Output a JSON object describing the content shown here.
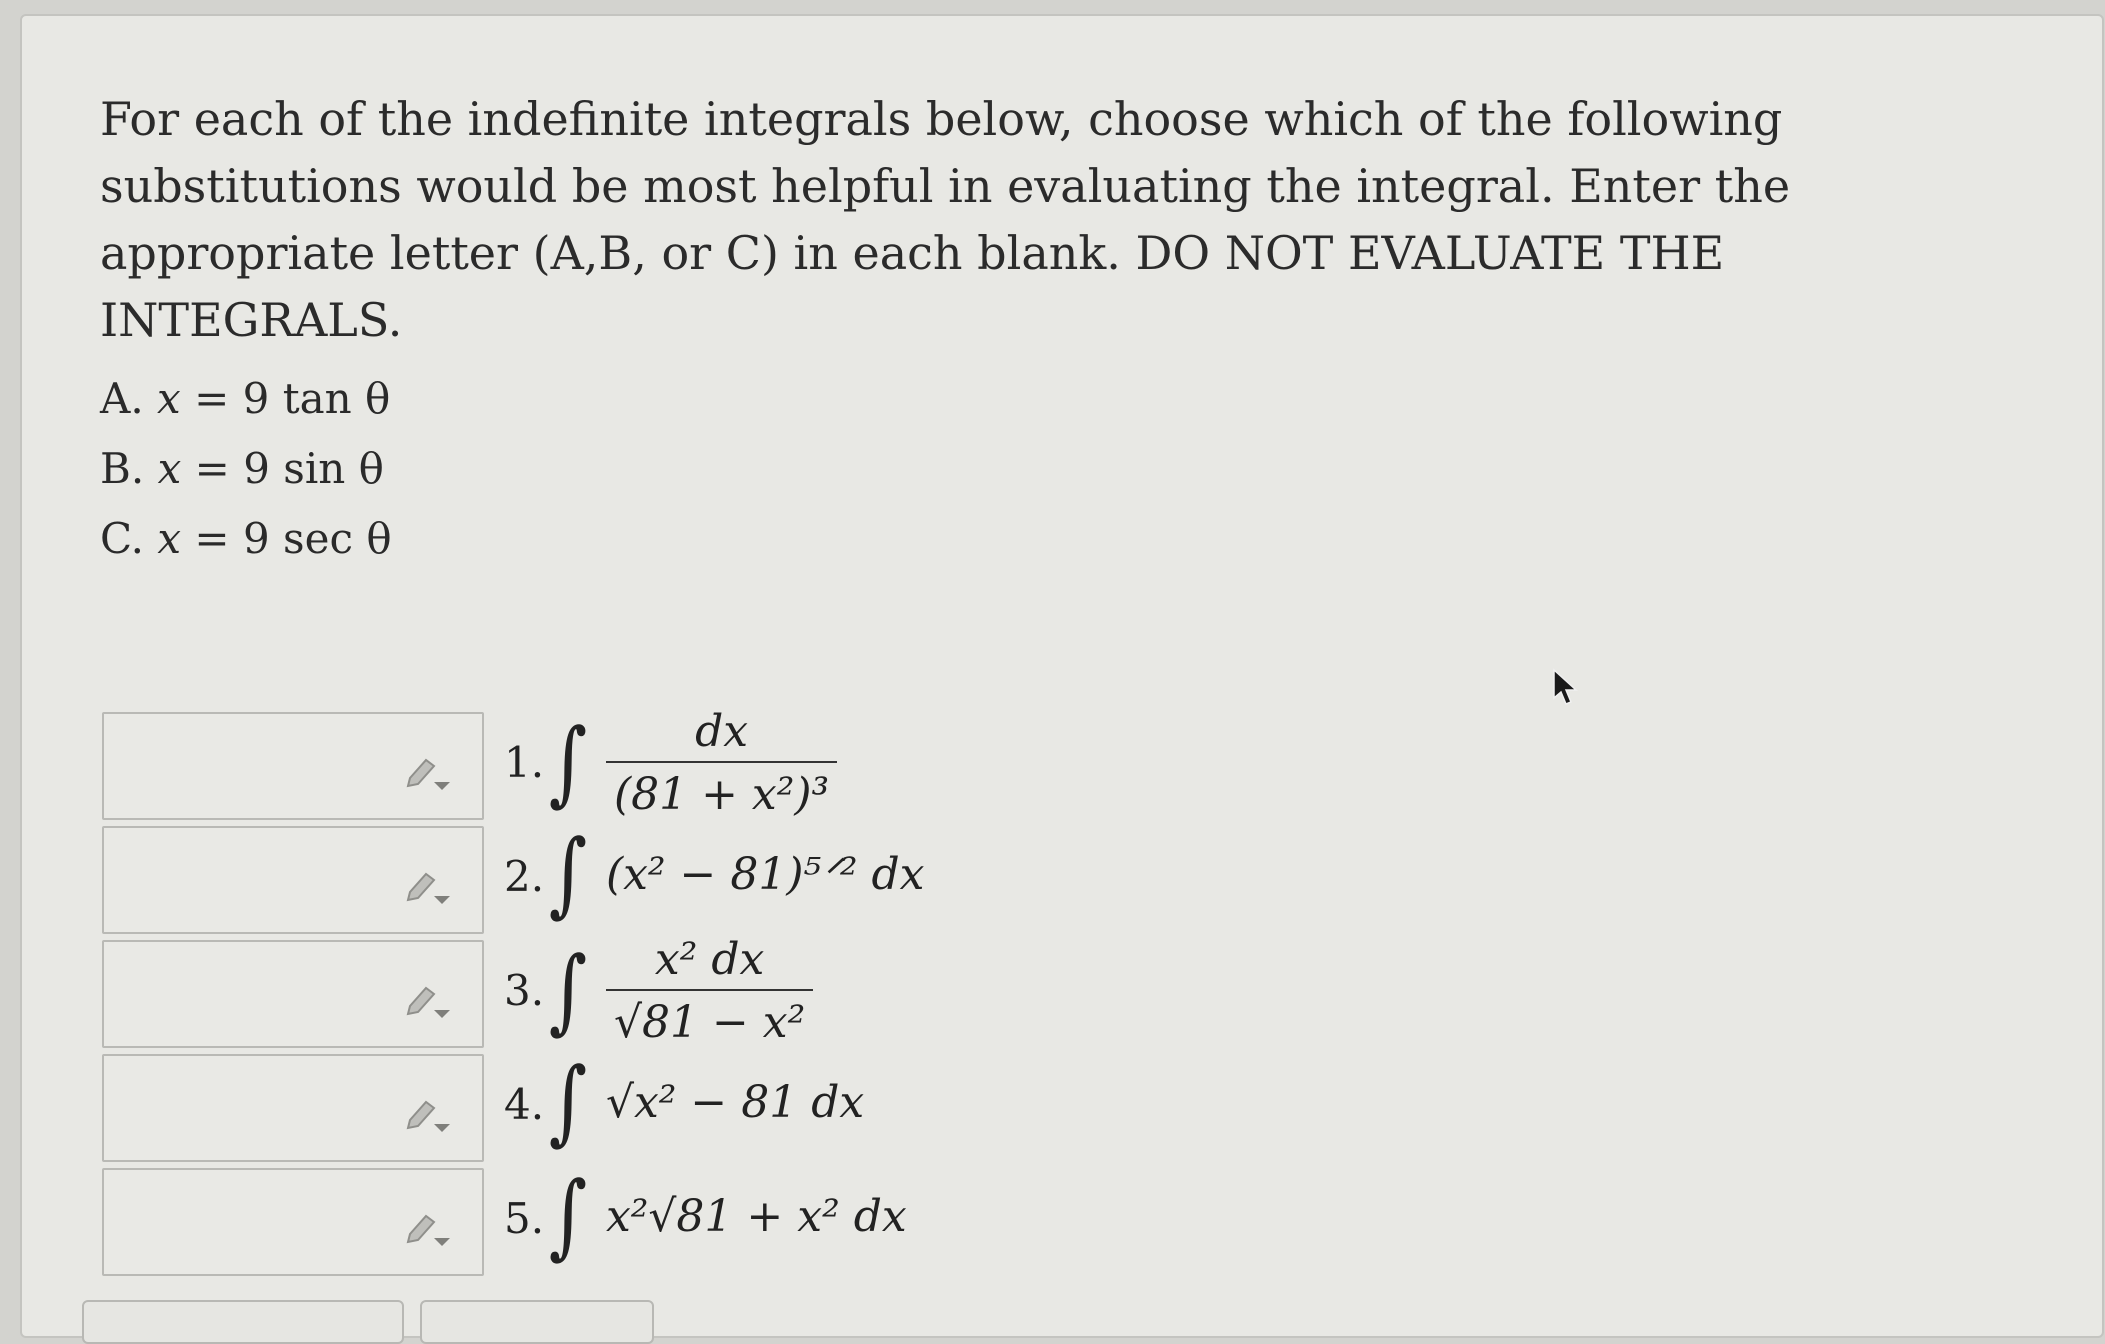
{
  "question": {
    "text": "For each of the indefinite integrals below, choose which of the following substitutions would be most helpful in evaluating the integral. Enter the appropriate letter (A,B, or C) in each blank. DO NOT EVALUATE THE INTEGRALS."
  },
  "choices": [
    {
      "letter": "A.",
      "var": "x",
      "eq": "=",
      "rhs": "9 tan θ"
    },
    {
      "letter": "B.",
      "var": "x",
      "eq": "=",
      "rhs": "9 sin θ"
    },
    {
      "letter": "C.",
      "var": "x",
      "eq": "=",
      "rhs": "9 sec θ"
    }
  ],
  "items": [
    {
      "number": "1.",
      "integrand": {
        "num": "dx",
        "den": "(81 + x²)³"
      },
      "answer": ""
    },
    {
      "number": "2.",
      "integrand": {
        "expr": "(x² − 81)⁵ᐟ² dx"
      },
      "answer": ""
    },
    {
      "number": "3.",
      "integrand": {
        "num": "x² dx",
        "den": "√81 − x²"
      },
      "answer": ""
    },
    {
      "number": "4.",
      "integrand": {
        "expr": "√x² − 81 dx"
      },
      "answer": ""
    },
    {
      "number": "5.",
      "integrand": {
        "expr": "x²√81 + x² dx"
      },
      "answer": ""
    }
  ],
  "icons": {
    "answer_tool": "pencil-dropdown-icon",
    "cursor": "mouse-pointer-icon"
  },
  "colors": {
    "background": "#e8e8e4",
    "border": "#b9b9b5",
    "text": "#2a2a2a"
  }
}
